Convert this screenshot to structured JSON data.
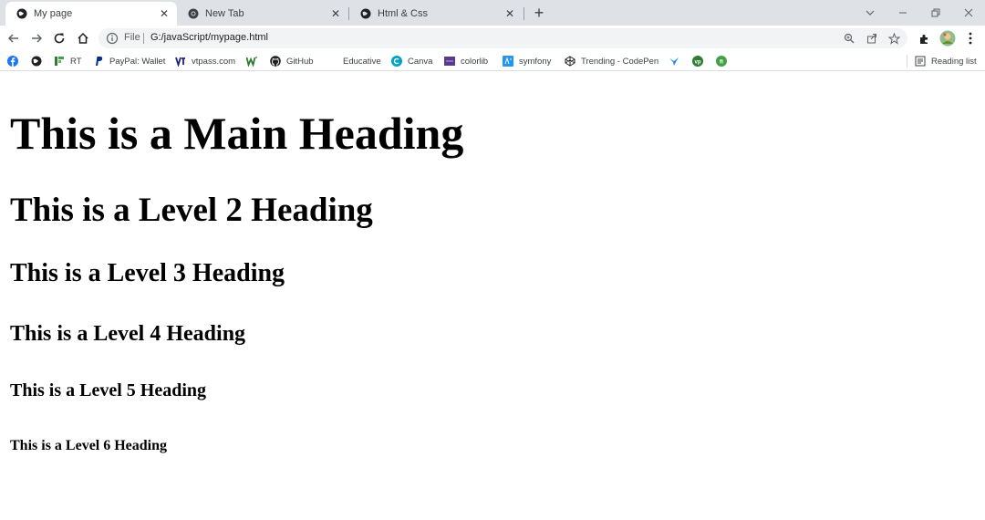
{
  "browser": {
    "tabs": [
      {
        "title": "My page",
        "active": true
      },
      {
        "title": "New Tab",
        "active": false
      },
      {
        "title": "Html & Css",
        "active": false
      }
    ],
    "new_tab_label": "+",
    "address": {
      "scheme_label": "File",
      "url": "G:/javaScript/mypage.html"
    },
    "bookmarks": [
      {
        "label": "",
        "icon": "facebook-icon"
      },
      {
        "label": "",
        "icon": "globe-icon"
      },
      {
        "label": "RT",
        "icon": "rt-icon"
      },
      {
        "label": "PayPal: Wallet",
        "icon": "paypal-icon"
      },
      {
        "label": "vtpass.com",
        "icon": "vtpass-icon"
      },
      {
        "label": "",
        "icon": "w-icon"
      },
      {
        "label": "GitHub",
        "icon": "github-icon"
      },
      {
        "label": "Educative",
        "icon": "none"
      },
      {
        "label": "Canva",
        "icon": "canva-icon"
      },
      {
        "label": "colorlib",
        "icon": "colorlib-icon"
      },
      {
        "label": "symfony",
        "icon": "symfony-icon"
      },
      {
        "label": "Trending - CodePen",
        "icon": "codepen-icon"
      },
      {
        "label": "",
        "icon": "bird-icon"
      },
      {
        "label": "",
        "icon": "vp-icon"
      },
      {
        "label": "",
        "icon": "fi-icon"
      }
    ],
    "reading_list_label": "Reading list"
  },
  "page": {
    "h1": "This is a Main Heading",
    "h2": "This is a Level 2 Heading",
    "h3": "This is a Level 3 Heading",
    "h4": "This is a Level 4 Heading",
    "h5": "This is a Level 5 Heading",
    "h6": "This is a Level 6 Heading"
  },
  "colors": {
    "tabstrip_bg": "#dee1e6",
    "omnibox_bg": "#f1f3f4",
    "page_bg": "#ffffff",
    "text": "#000000"
  }
}
